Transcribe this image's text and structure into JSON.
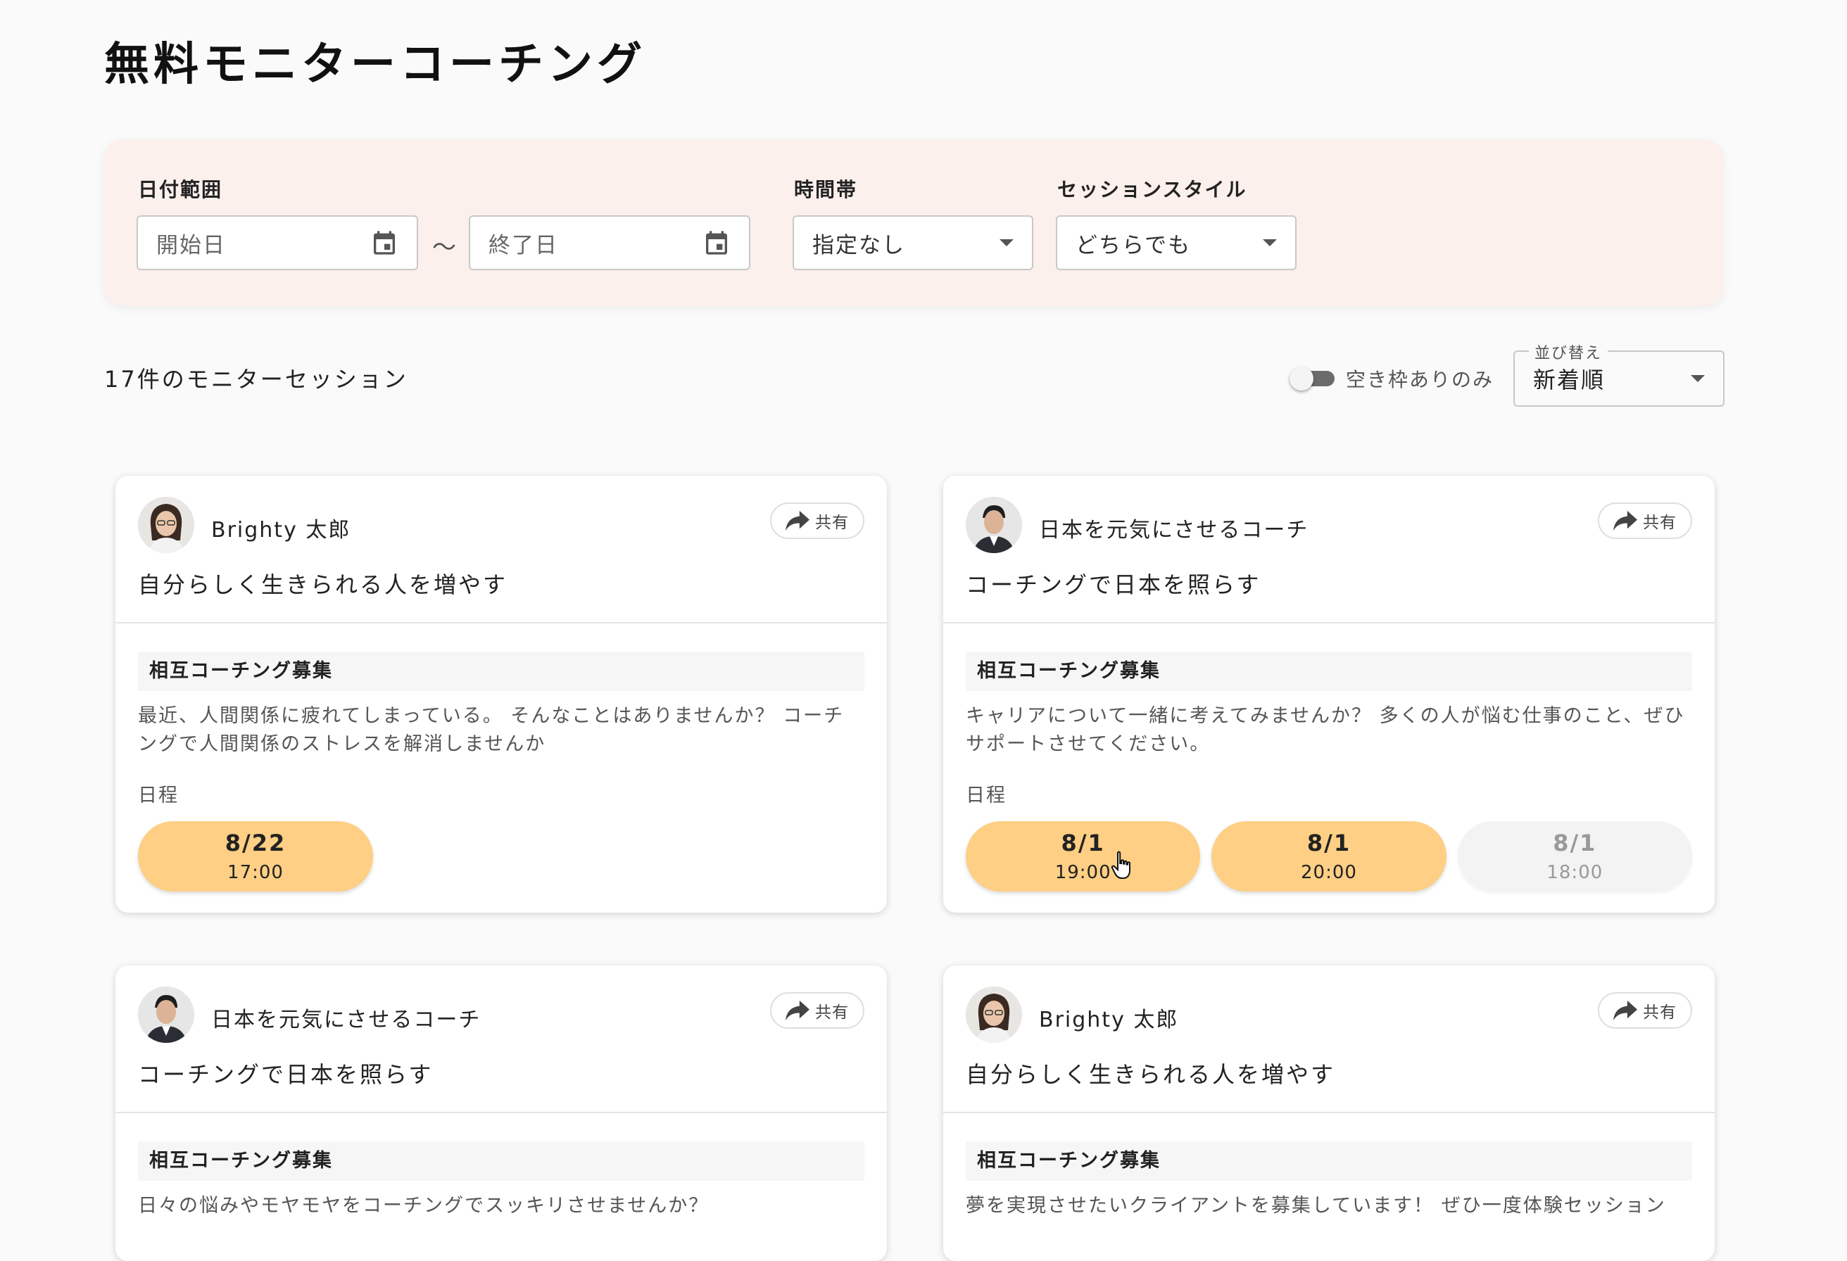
{
  "page": {
    "title": "無料モニターコーチング"
  },
  "filters": {
    "date_range": {
      "label": "日付範囲",
      "start_placeholder": "開始日",
      "end_placeholder": "終了日",
      "separator": "〜"
    },
    "time_slot": {
      "label": "時間帯",
      "value": "指定なし"
    },
    "session_style": {
      "label": "セッションスタイル",
      "value": "どちらでも"
    }
  },
  "results": {
    "count_text": "17件のモニターセッション",
    "availability_toggle": {
      "label": "空き枠ありのみ",
      "on": false
    },
    "sort": {
      "legend": "並び替え",
      "value": "新着順"
    }
  },
  "share_label": "共有",
  "cards": [
    {
      "coach": "Brighty 太郎",
      "tagline": "自分らしく生きられる人を増やす",
      "recruit_title": "相互コーチング募集",
      "description": "最近、人間関係に疲れてしまっている。 そんなことはありませんか？ コーチングで人間関係のストレスを解消しませんか",
      "schedule_label": "日程",
      "slots": [
        {
          "date": "8/22",
          "time": "17:00",
          "available": true
        }
      ]
    },
    {
      "coach": "日本を元気にさせるコーチ",
      "tagline": "コーチングで日本を照らす",
      "recruit_title": "相互コーチング募集",
      "description": "キャリアについて一緒に考えてみませんか？ 多くの人が悩む仕事のこと、ぜひサポートさせてください。",
      "schedule_label": "日程",
      "slots": [
        {
          "date": "8/1",
          "time": "19:00",
          "available": true
        },
        {
          "date": "8/1",
          "time": "20:00",
          "available": true
        },
        {
          "date": "8/1",
          "time": "18:00",
          "available": false
        }
      ]
    },
    {
      "coach": "日本を元気にさせるコーチ",
      "tagline": "コーチングで日本を照らす",
      "recruit_title": "相互コーチング募集",
      "description": "日々の悩みやモヤモヤをコーチングでスッキリさせませんか？"
    },
    {
      "coach": "Brighty 太郎",
      "tagline": "自分らしく生きられる人を増やす",
      "recruit_title": "相互コーチング募集",
      "description": "夢を実現させたいクライアントを募集しています！ ぜひ一度体験セッション"
    }
  ]
}
